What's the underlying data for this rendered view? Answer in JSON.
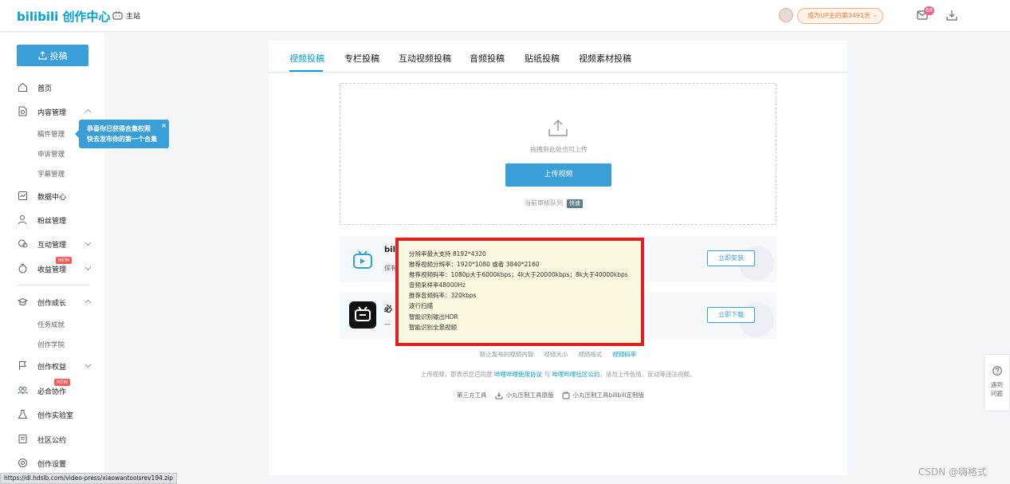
{
  "header": {
    "logo_text": "bilibili 创作中心",
    "home_label": "主站",
    "up_pill": "成为UP主的第3491天",
    "message_count": "68"
  },
  "sidebar": {
    "upload_label": "投稿",
    "items": [
      {
        "label": "首页"
      },
      {
        "label": "内容管理"
      },
      {
        "label": "稿件管理"
      },
      {
        "label": "申诉管理"
      },
      {
        "label": "字幕管理"
      },
      {
        "label": "数据中心"
      },
      {
        "label": "粉丝管理"
      },
      {
        "label": "互动管理"
      },
      {
        "label": "收益管理"
      },
      {
        "label": "创作成长"
      },
      {
        "label": "任务成就"
      },
      {
        "label": "创作学院"
      },
      {
        "label": "创作权益"
      },
      {
        "label": "必合协作"
      },
      {
        "label": "创作实验室"
      },
      {
        "label": "社区公约"
      },
      {
        "label": "创作设置"
      }
    ],
    "new_badge": "NEW",
    "tip_line1": "恭喜你已获得合集权限",
    "tip_line2": "快去发布你的第一个合集",
    "tip_close": "×"
  },
  "main": {
    "tabs": [
      {
        "label": "视频投稿"
      },
      {
        "label": "专栏投稿"
      },
      {
        "label": "互动视频投稿"
      },
      {
        "label": "音频投稿"
      },
      {
        "label": "贴纸投稿"
      },
      {
        "label": "视频素材投稿"
      }
    ],
    "drop_hint": "拖拽到此处也可上传",
    "upload_video_button": "上传视频",
    "queue_label": "当前审核队列",
    "queue_badge": "快速",
    "promo1": {
      "title": "bil",
      "desc": "保有",
      "button": "立即安装"
    },
    "promo2": {
      "title": "必",
      "desc": "一",
      "button": "立即下载"
    },
    "tooltip_lines": [
      "分辨率最大支持 8192*4320",
      "推荐视频分辨率：1920*1080 或者 3840*2160",
      "推荐视频码率：1080p大于6000kbps；4k大于20000kbps；8k大于40000kbps",
      "音频采样率48000Hz",
      "推荐音频码率：320kbps",
      "逐行扫描",
      "智能识别输出HDR",
      "智能识别全景视频"
    ],
    "links": [
      {
        "label": "禁止发布的视频内容"
      },
      {
        "label": "视频大小"
      },
      {
        "label": "视频格式"
      },
      {
        "label": "视频码率"
      }
    ],
    "agree_prefix": "上传视频，即表示您已同意",
    "agree_link1": "哔哩哔哩使用协议",
    "agree_mid": "与",
    "agree_link2": "哔哩哔哩社区公约",
    "agree_suffix": "，请勿上传色情，反动等违法视频。",
    "tools_label": "第三方工具",
    "tool1": "小丸压制工具原版",
    "tool2": "小丸压制工具bilibili定制版"
  },
  "help": {
    "line1": "遇到",
    "line2": "问题"
  },
  "statusbar_url": "https://dl.hdslb.com/video-press/xiaowantoolsrev194.zip",
  "watermark": "CSDN @嗨格式"
}
